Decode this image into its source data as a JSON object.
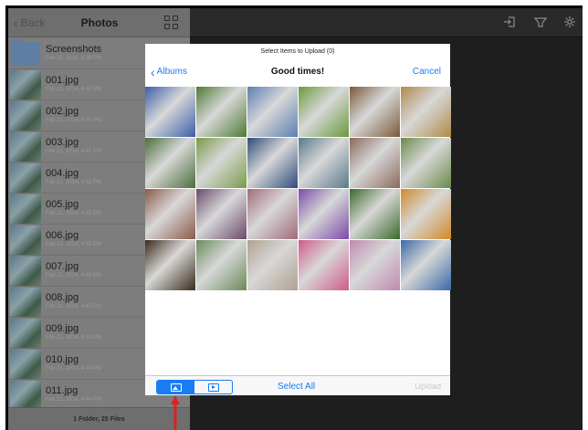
{
  "sidebar": {
    "back_label": "Back",
    "title": "Photos",
    "items": [
      {
        "name": "Screenshots",
        "date": "Feb 21, 2014, 6:09 PM",
        "kind": "folder"
      },
      {
        "name": "001.jpg",
        "date": "Feb 21, 2014, 4:40 PM",
        "kind": "photo"
      },
      {
        "name": "002.jpg",
        "date": "Feb 21, 2014, 4:41 PM",
        "kind": "photo"
      },
      {
        "name": "003.jpg",
        "date": "Feb 21, 2014, 4:41 PM",
        "kind": "photo"
      },
      {
        "name": "004.jpg",
        "date": "Feb 21, 2014, 4:42 PM",
        "kind": "photo"
      },
      {
        "name": "005.jpg",
        "date": "Feb 21, 2014, 4:42 PM",
        "kind": "photo"
      },
      {
        "name": "006.jpg",
        "date": "Feb 21, 2014, 4:42 PM",
        "kind": "photo"
      },
      {
        "name": "007.jpg",
        "date": "Feb 21, 2014, 4:43 PM",
        "kind": "photo"
      },
      {
        "name": "008.jpg",
        "date": "Feb 21, 2014, 4:43 PM",
        "kind": "photo"
      },
      {
        "name": "009.jpg",
        "date": "Feb 21, 2014, 4:43 PM",
        "kind": "photo"
      },
      {
        "name": "010.jpg",
        "date": "Feb 21, 2014, 4:44 PM",
        "kind": "photo"
      },
      {
        "name": "011.jpg",
        "date": "Feb 21, 2014, 4:44 PM",
        "kind": "photo"
      }
    ],
    "footer": "1 Folder, 25 Files"
  },
  "topbar": {
    "icons": [
      "sign-in-icon",
      "filter-icon",
      "gear-icon"
    ]
  },
  "modal": {
    "subtitle": "Select Items to Upload (0)",
    "back_label": "Albums",
    "title": "Good times!",
    "cancel_label": "Cancel",
    "select_all_label": "Select All",
    "upload_label": "Upload",
    "photo_colors": [
      "#3a5fa8",
      "#4f7a34",
      "#5a7fb0",
      "#6a9a3c",
      "#7a5a3a",
      "#b08a4a",
      "#4a6e3a",
      "#7a9a4a",
      "#2e4a7a",
      "#5a7a8a",
      "#8a6a5a",
      "#6a8a4a",
      "#8a5a4a",
      "#6a4a6a",
      "#a06a7a",
      "#7a4aa8",
      "#3a6a2a",
      "#d08a2a",
      "#3a2a1a",
      "#6a8a5a",
      "#b0a090",
      "#d05a8a",
      "#c08ab0",
      "#3a6aa8"
    ]
  },
  "colors": {
    "accent": "#1a7cf5",
    "arrow": "#e02020",
    "sidebar_bg": "#7d7d7d",
    "main_bg": "#1e1e1e"
  }
}
